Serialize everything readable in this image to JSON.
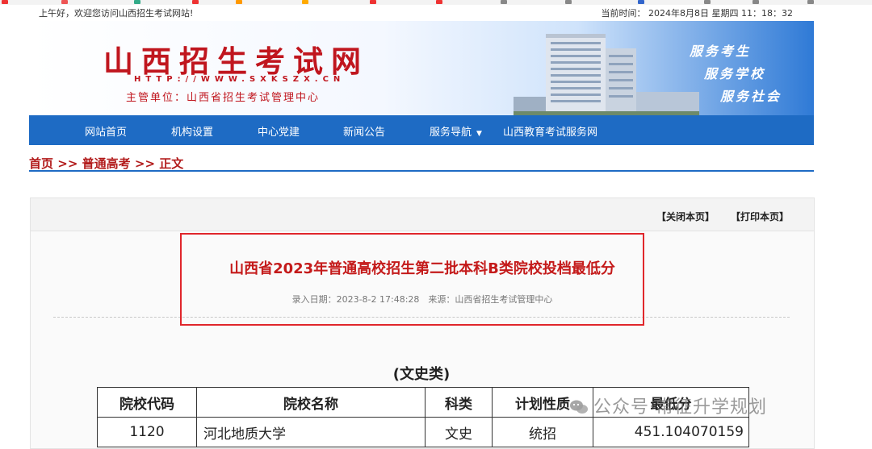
{
  "topbar": {
    "greeting": "上午好，欢迎您访问山西招生考试网站!",
    "datetime": "当前时间： 2024年8月8日 星期四 11：18：32"
  },
  "banner": {
    "site_name": "山西招生考试网",
    "url_text": "HTTP://WWW.SXKSZX.CN",
    "org_text": "主管单位：山西省招生考试管理中心",
    "slogans": [
      "服务考生",
      "服务学校",
      "服务社会"
    ]
  },
  "nav": {
    "items": [
      "网站首页",
      "机构设置",
      "中心党建",
      "新闻公告",
      "服务导航",
      "山西教育考试服务网"
    ]
  },
  "breadcrumb": {
    "home": "首页",
    "sep1": ">>",
    "category": "普通高考",
    "sep2": ">>",
    "current": "正文"
  },
  "article": {
    "close_label": "【关闭本页】",
    "print_label": "【打印本页】",
    "title": "山西省2023年普通高校招生第二批本科B类院校投档最低分",
    "meta": "录入日期：2023-8-2 17:48:28　来源：山西省招生考试管理中心",
    "section": "(文史类)"
  },
  "table": {
    "headers": [
      "院校代码",
      "院校名称",
      "科类",
      "计划性质",
      "最低分"
    ],
    "rows": [
      [
        "1120",
        "河北地质大学",
        "文史",
        "统招",
        "451.104070159"
      ]
    ]
  },
  "watermark": {
    "text": "公众号·常征升学规划"
  },
  "colors": {
    "brand_red": "#c0161e",
    "nav_blue": "#1e6bc4",
    "highlight_red": "#e0262b"
  }
}
